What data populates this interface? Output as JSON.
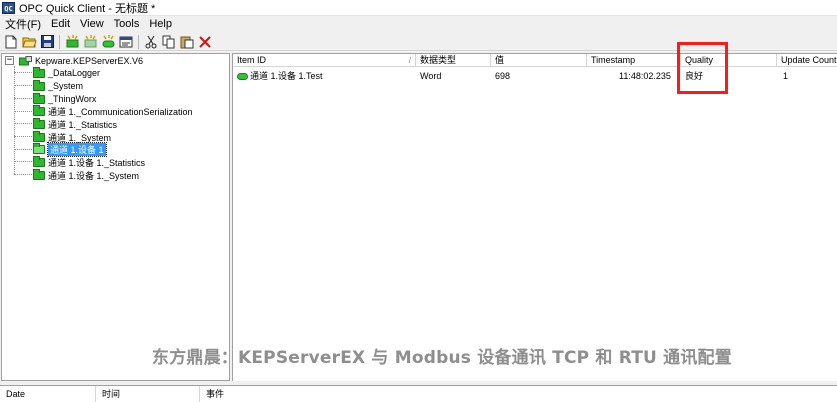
{
  "window": {
    "title": "OPC Quick Client - 无标题 *",
    "icon_text": "QC"
  },
  "menu": [
    "文件(F)",
    "Edit",
    "View",
    "Tools",
    "Help"
  ],
  "tree": {
    "root": "Kepware.KEPServerEX.V6",
    "items": [
      "_DataLogger",
      "_System",
      "_ThingWorx",
      "通道 1._CommunicationSerialization",
      "通道 1._Statistics",
      "通道 1._System",
      "通道 1.设备 1",
      "通道 1.设备 1._Statistics",
      "通道 1.设备 1._System"
    ],
    "selected_index": 6
  },
  "list": {
    "columns": [
      "Item ID",
      "数据类型",
      "值",
      "Timestamp",
      "Quality",
      "Update Count"
    ],
    "rows": [
      [
        "通道 1.设备 1.Test",
        "Word",
        "698",
        "11:48:02.235",
        "良好",
        "1"
      ]
    ]
  },
  "log": {
    "columns": [
      "Date",
      "时间",
      "事件"
    ]
  },
  "watermark": "东方鼎晨：KEPServerEX 与 Modbus 设备通讯 TCP 和 RTU 通讯配置",
  "colors": {
    "highlight": "#ff1a1a",
    "selection": "#3399ff",
    "folder": "#2fb82f"
  }
}
